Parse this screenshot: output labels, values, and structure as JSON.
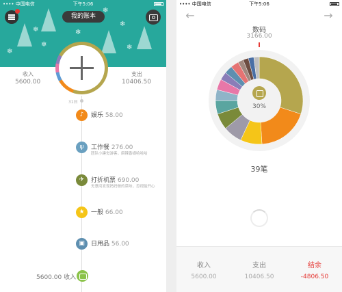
{
  "left": {
    "status": {
      "carrier": "•••• 中国电信",
      "time": "下午5:06"
    },
    "header": {
      "book_button": "我的账本"
    },
    "summary": {
      "income_label": "收入",
      "income_value": "5600.00",
      "expense_label": "支出",
      "expense_value": "10406.50"
    },
    "date_label": "31日",
    "items": [
      {
        "name": "娱乐",
        "amount": "58.00",
        "note": "",
        "color": "#f28a1a",
        "icon": "mic-icon"
      },
      {
        "name": "工作餐",
        "amount": "276.00",
        "note": "团队小建觉游客，麻辣香锅哈哈哈",
        "color": "#6aa0c0",
        "icon": "cutlery-icon"
      },
      {
        "name": "打折机票",
        "amount": "690.00",
        "note": "无意间发现妈妈做的菜味，忽视能开心",
        "color": "#7a8a3a",
        "icon": "plane-icon"
      },
      {
        "name": "一般",
        "amount": "66.00",
        "note": "",
        "color": "#f5c518",
        "icon": "star-icon"
      },
      {
        "name": "日用品",
        "amount": "56.00",
        "note": "",
        "color": "#5e8fb0",
        "icon": "box-icon"
      }
    ],
    "income_row": {
      "value": "5600.00",
      "label": "收入"
    }
  },
  "right": {
    "status": {
      "carrier": "•••• 中国电信",
      "time": "下午5:06"
    },
    "category": {
      "name": "数码",
      "amount": "3166.00",
      "percent": "30%"
    },
    "count": "39笔",
    "chart_data": {
      "type": "pie",
      "values": [
        30,
        19,
        8,
        7,
        6,
        5,
        4,
        4,
        3,
        3,
        3,
        2,
        2,
        2,
        2
      ],
      "colors": [
        "#b5a64e",
        "#f28a1a",
        "#f5c518",
        "#9e9aa8",
        "#7a8a3a",
        "#5aa5a0",
        "#8fb4c8",
        "#e877a8",
        "#8a7db8",
        "#5e8fb0",
        "#e57373",
        "#a1887f",
        "#6d4c41",
        "#4a6fa5",
        "#c0c0c0"
      ]
    },
    "bottom": {
      "income_label": "收入",
      "income_value": "5600.00",
      "expense_label": "支出",
      "expense_value": "10406.50",
      "balance_label": "结余",
      "balance_value": "-4806.50"
    }
  }
}
